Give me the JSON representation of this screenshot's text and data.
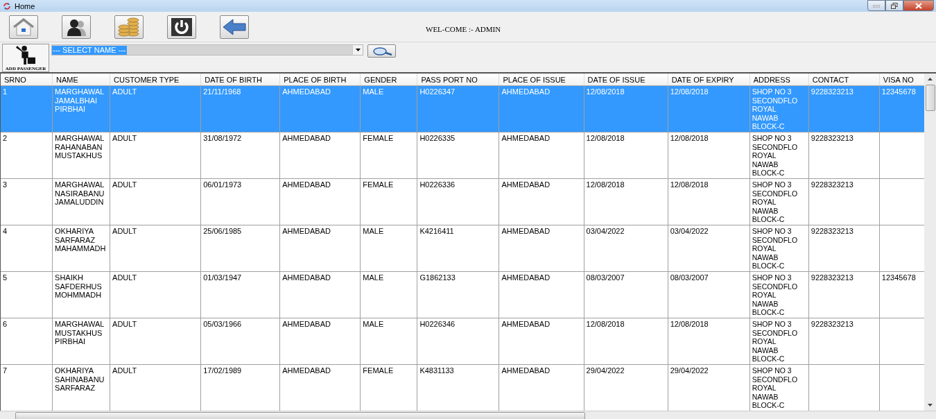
{
  "window": {
    "title": "Home"
  },
  "toolbar": {
    "welcome": "WEL-COME :- ADMIN"
  },
  "passenger_button": {
    "label": "ADD PASSENGER"
  },
  "name_select": {
    "value": "--- SELECT NAME ---"
  },
  "table": {
    "columns": [
      "SRNO",
      "NAME",
      "CUSTOMER TYPE",
      "DATE OF BIRTH",
      "PLACE OF BIRTH",
      "GENDER",
      "PASS PORT NO",
      "PLACE OF ISSUE",
      "DATE OF ISSUE",
      "DATE OF EXPIRY",
      "ADDRESS",
      "CONTACT",
      "VISA NO"
    ],
    "rows": [
      {
        "selected": true,
        "cells": [
          "1",
          "MARGHAWAL\nJAMALBHAI\nPIRBHAI",
          "ADULT",
          "21/11/1968",
          "AHMEDABAD",
          "MALE",
          "H0226347",
          "AHMEDABAD",
          "12/08/2018",
          "12/08/2018",
          "SHOP NO 3\nSECONDFLO\nROYAL\nNAWAB\nBLOCK-C",
          "9228323213",
          "12345678"
        ]
      },
      {
        "selected": false,
        "cells": [
          "2",
          "MARGHAWAL\nRAHANABAN\nMUSTAKHUS",
          "ADULT",
          "31/08/1972",
          "AHMEDABAD",
          "FEMALE",
          "H0226335",
          "AHMEDABAD",
          "12/08/2018",
          "12/08/2018",
          "SHOP NO 3\nSECONDFLO\nROYAL\nNAWAB\nBLOCK-C",
          "9228323213",
          ""
        ]
      },
      {
        "selected": false,
        "cells": [
          "3",
          "MARGHAWAL\nNASIRABANU\nJAMALUDDIN",
          "ADULT",
          "06/01/1973",
          "AHMEDABAD",
          "FEMALE",
          "H0226336",
          "AHMEDABAD",
          "12/08/2018",
          "12/08/2018",
          "SHOP NO 3\nSECONDFLO\nROYAL\nNAWAB\nBLOCK-C",
          "9228323213",
          ""
        ]
      },
      {
        "selected": false,
        "cells": [
          "4",
          "OKHARIYA\nSARFARAZ\nMAHAMMADH",
          "ADULT",
          "25/06/1985",
          "AHMEDABAD",
          "MALE",
          "K4216411",
          "AHMEDABAD",
          "03/04/2022",
          "03/04/2022",
          "SHOP NO 3\nSECONDFLO\nROYAL\nNAWAB\nBLOCK-C",
          "9228323213",
          ""
        ]
      },
      {
        "selected": false,
        "cells": [
          "5",
          "SHAIKH\nSAFDERHUS\nMOHMMADH",
          "ADULT",
          "01/03/1947",
          "AHMEDABAD",
          "MALE",
          "G1862133",
          "AHMEDABAD",
          "08/03/2007",
          "08/03/2007",
          "SHOP NO 3\nSECONDFLO\nROYAL\nNAWAB\nBLOCK-C",
          "9228323213",
          "12345678"
        ]
      },
      {
        "selected": false,
        "cells": [
          "6",
          "MARGHAWAL\nMUSTAKHUS\nPIRBHAI",
          "ADULT",
          "05/03/1966",
          "AHMEDABAD",
          "MALE",
          "H0226346",
          "AHMEDABAD",
          "12/08/2018",
          "12/08/2018",
          "SHOP NO 3\nSECONDFLO\nROYAL\nNAWAB\nBLOCK-C",
          "9228323213",
          ""
        ]
      },
      {
        "selected": false,
        "cells": [
          "7",
          "OKHARIYA\nSAHINABANU\nSARFARAZ",
          "ADULT",
          "17/02/1989",
          "AHMEDABAD",
          "FEMALE",
          "K4831133",
          "AHMEDABAD",
          "29/04/2022",
          "29/04/2022",
          "SHOP NO 3\nSECONDFLO\nROYAL\nNAWAB\nBLOCK-C",
          "",
          ""
        ]
      }
    ]
  }
}
